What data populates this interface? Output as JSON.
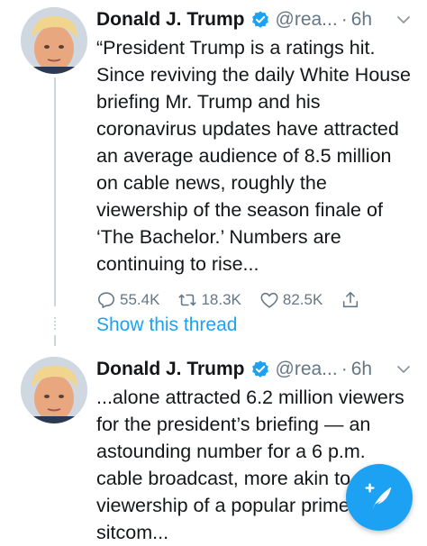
{
  "tweets": [
    {
      "name": "Donald J. Trump",
      "handle": "@rea...",
      "dot": "·",
      "time": "6h",
      "text": "“President Trump is a ratings hit. Since reviving the daily White House briefing Mr. Trump and his coronavirus updates have attracted an average audience of 8.5 million on cable news, roughly the viewership of the season finale of ‘The Bachelor.’ Numbers are continuing to rise...",
      "replies": "55.4K",
      "retweets": "18.3K",
      "likes": "82.5K"
    },
    {
      "name": "Donald J. Trump",
      "handle": "@rea...",
      "dot": "·",
      "time": "6h",
      "text": "...alone attracted 6.2 million viewers for the president’s briefing — an astounding number for a 6 p.m. cable broadcast, more akin to the viewership of a popular prime-time sitcom..."
    }
  ],
  "show_thread": "Show this thread",
  "colors": {
    "accent": "#1da1f2",
    "muted": "#657786",
    "line": "#ccd6dd"
  },
  "icons": [
    "verified-badge-icon",
    "caret-down-icon",
    "reply-icon",
    "retweet-icon",
    "like-icon",
    "share-icon",
    "compose-tweet-icon"
  ]
}
